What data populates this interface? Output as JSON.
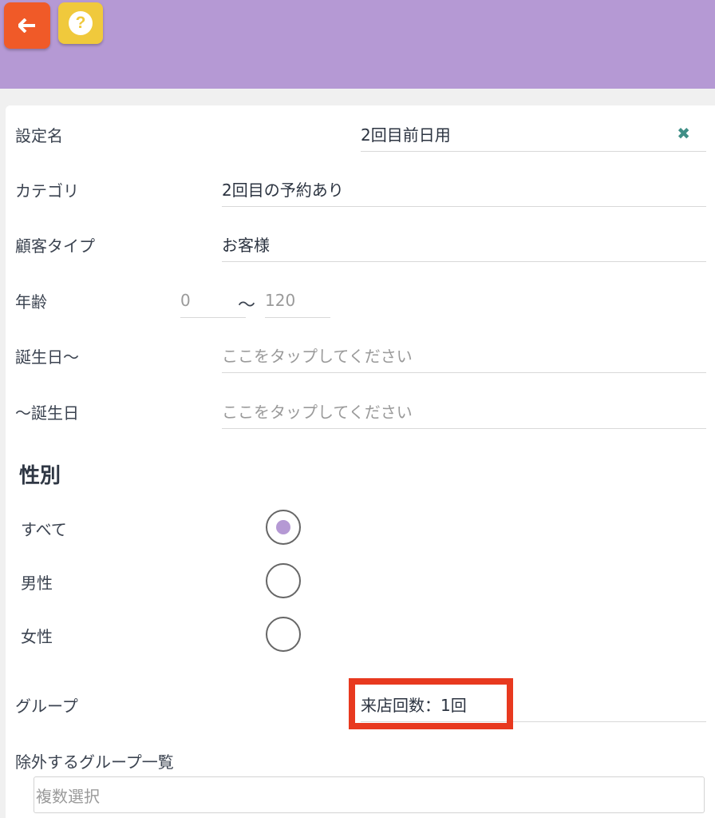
{
  "header": {
    "back_icon": "arrow-left-icon",
    "help_icon": "question-circle-icon",
    "help_glyph": "?",
    "colors": {
      "bar": "#b599d4",
      "back": "#f05a28",
      "help": "#f0c93c"
    }
  },
  "form": {
    "setting_name": {
      "label": "設定名",
      "value": "2回目前日用"
    },
    "category": {
      "label": "カテゴリ",
      "value": "2回目の予約あり"
    },
    "customer_type": {
      "label": "顧客タイプ",
      "value": "お客様"
    },
    "age": {
      "label": "年齢",
      "min_placeholder": "0",
      "separator": "〜",
      "max_placeholder": "120"
    },
    "birthday_from": {
      "label": "誕生日〜",
      "placeholder": "ここをタップしてください"
    },
    "birthday_to": {
      "label": "〜誕生日",
      "placeholder": "ここをタップしてください"
    },
    "gender": {
      "title": "性別",
      "options": [
        {
          "label": "すべて",
          "selected": true
        },
        {
          "label": "男性",
          "selected": false
        },
        {
          "label": "女性",
          "selected": false
        }
      ]
    },
    "group": {
      "label": "グループ",
      "value": "来店回数：1回"
    },
    "excluded_groups": {
      "label": "除外するグループ一覧",
      "placeholder": "複数選択"
    }
  },
  "accent_colors": {
    "radio_fill": "#b599d4",
    "clear": "#3f8e86",
    "highlight": "#e8391f"
  }
}
